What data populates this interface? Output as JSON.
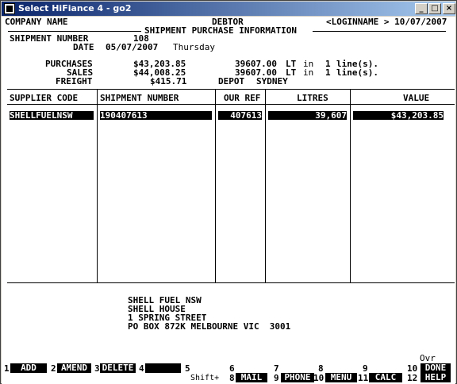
{
  "window": {
    "title": "Select HiFiance 4 - go2"
  },
  "header": {
    "company": "COMPANY NAME",
    "module": "DEBTOR",
    "user_date": "<LOGINNAME > 10/07/2007",
    "section_title": "SHIPMENT PURCHASE INFORMATION"
  },
  "shipment": {
    "number_label": "SHIPMENT NUMBER",
    "number_value": "108",
    "date_label": "DATE",
    "date_value": "05/07/2007",
    "day_value": "Thursday"
  },
  "summary": {
    "purchases_label": "PURCHASES",
    "purchases_value": "$43,203.85",
    "purchases_litres": "39607.00",
    "sales_label": "SALES",
    "sales_value": "$44,008.25",
    "sales_litres": "39607.00",
    "unit": "LT",
    "in_label": "in",
    "line_count": "1",
    "lines_label": "line(s).",
    "freight_label": "FREIGHT",
    "freight_value": "$415.71",
    "depot_label": "DEPOT",
    "depot_value": "SYDNEY"
  },
  "table": {
    "headers": [
      "SUPPLIER CODE",
      "SHIPMENT NUMBER",
      "OUR REF",
      "LITRES",
      "VALUE"
    ],
    "rows": [
      {
        "supplier": "SHELLFUELNSW",
        "shipment": "190407613",
        "ref": "407613",
        "litres": "39,607",
        "value": "$43,203.85"
      }
    ]
  },
  "supplier_address": {
    "line1": "SHELL FUEL NSW",
    "line2": "SHELL HOUSE",
    "line3": "1 SPRING STREET",
    "line4": "PO BOX 872K MELBOURNE VIC  3001"
  },
  "status": {
    "ovr": "Ovr",
    "shift": "Shift+"
  },
  "fkeys": {
    "f1": {
      "num": "1",
      "label": "ADD"
    },
    "f2": {
      "num": "2",
      "label": "AMEND"
    },
    "f3": {
      "num": "3",
      "label": "DELETE"
    },
    "f4": {
      "num": "4",
      "label": ""
    },
    "f5": {
      "num": "5",
      "label": ""
    },
    "f6": {
      "num": "6",
      "num2": "8",
      "label": "MAIL"
    },
    "f7": {
      "num": "7",
      "num2": "9",
      "label": "PHONE"
    },
    "f8": {
      "num": "8",
      "num2": "10",
      "label": "MENU"
    },
    "f9": {
      "num": "9",
      "num2": "11",
      "label": "CALC"
    },
    "f10": {
      "num": "10",
      "num2": "12",
      "label": "DONE",
      "label2": "HELP"
    }
  }
}
